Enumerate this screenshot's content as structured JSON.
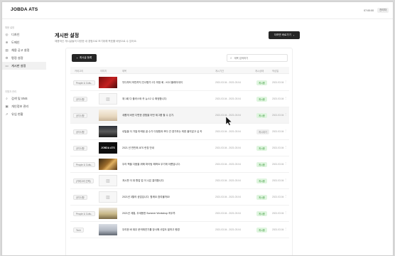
{
  "app": {
    "title": "JOBDA ATS"
  },
  "topbar": {
    "clock": "07:00:00",
    "user": "관리자"
  },
  "sidebar": {
    "section1": "채용 설정",
    "section2": "지원자 관리",
    "items": [
      {
        "label": "디자인",
        "icon": "palette-icon"
      },
      {
        "label": "도메인",
        "icon": "globe-icon"
      },
      {
        "label": "채용 공고 설정",
        "icon": "document-icon"
      },
      {
        "label": "평정 설정",
        "icon": "gear-icon"
      },
      {
        "label": "게시판 설정",
        "icon": "board-icon",
        "active": true
      },
      {
        "label": "검색 및 SNS",
        "icon": "search-icon"
      },
      {
        "label": "개인정보 관리",
        "icon": "lock-icon"
      },
      {
        "label": "유입 현황",
        "icon": "chart-icon"
      }
    ]
  },
  "page": {
    "title": "게시판 설정",
    "description": "채용하신 게시글들의 다양한 내 경험으로 보기위해 목표를 바탕으로 수 있어요.",
    "help_button": "더하면 바로가기"
  },
  "panel": {
    "add_button": "게시글 등록",
    "search_placeholder": "제목 검색하기",
    "headers": [
      "카테고리",
      "이미지",
      "제목",
      "게시기간",
      "게시상태",
      "작성일"
    ]
  },
  "rows": [
    {
      "category": "People & Cultu..",
      "thumb": "red",
      "title": "잇다부터 하반까지 인사평가 2주 미정 회 - KCC플레이데이",
      "period": "2021.03.04 - 2021.03.04",
      "status": "게시중",
      "status_on": true,
      "date": "2021.03.04"
    },
    {
      "category": "공지사항",
      "thumb": "img-icon",
      "title": "재 1회 다 플러스와 카 뉴스2 수 확정합니다.",
      "period": "2021.03.04 - 2021.03.04",
      "status": "게시중",
      "status_on": true,
      "date": "2021.03.04"
    },
    {
      "category": "공지사항",
      "thumb": "group",
      "title": "새롭게 바뀐 다면한 경험을 어떤 제그룹 할 수 있기.",
      "period": "2021.03.04 - 2021.03.04",
      "status": "게시중",
      "status_on": true,
      "date": "2021.03.04",
      "hover": true
    },
    {
      "category": "공지사항",
      "thumb": "dark",
      "title": "내일을 더 거칠 마케팅 꿈 수가 다정함과 보다 관 경기하는 최한 울지않고 싶 카",
      "period": "2021.03.04 - 2021.03.04",
      "status": "게시대기",
      "status_on": false,
      "date": "2021.03.04"
    },
    {
      "category": "공지사항",
      "thumb": "logo",
      "thumb_text": "JOBDA ATS",
      "title": "2021 년 반반희 ATS 런칭 안내",
      "period": "2021.03.04 - 2021.03.04",
      "status": "게시중",
      "status_on": true,
      "date": "2021.03.04"
    },
    {
      "category": "People & Cultu..",
      "thumb": "gold",
      "title": "우리 책을 다음을 위해 파이팅 해봐요 우기에 아름답니다.",
      "period": "2021.03.04 - 2021.03.04",
      "status": "게시중",
      "status_on": true,
      "date": "2021.03.04"
    },
    {
      "category": "(카테고리 선택)",
      "thumb": "img-icon",
      "title": "게시판 이 대 항업 업 이 나은 흥미합니다.",
      "period": "2021.03.04 - 2021.03.04",
      "status": "게시중",
      "status_on": true,
      "date": "2021.03.04"
    },
    {
      "category": "공지사항",
      "thumb": "img-icon",
      "title": "2021년 3월의 공업입니다. 함께요 참여물까요!",
      "period": "2021.03.04 - 2021.03.04",
      "status": "게시중",
      "status_on": true,
      "date": "2021.03.04"
    },
    {
      "category": "People & Cultu..",
      "thumb": "event",
      "title": "2021년 계통, 우세용한 Summer Workshop 하우투",
      "period": "2021.03.04 - 2021.03.04",
      "status": "게시중",
      "status_on": true,
      "date": "2021.03.04"
    },
    {
      "category": "Tech",
      "thumb": "crowd",
      "title": "우리한 바 위우 문의에연기를 장사해 사업도 밑하고 행경",
      "period": "2021.03.04 - 2021.03.04",
      "status": "게시중",
      "status_on": true,
      "date": "2021.03.04"
    }
  ]
}
